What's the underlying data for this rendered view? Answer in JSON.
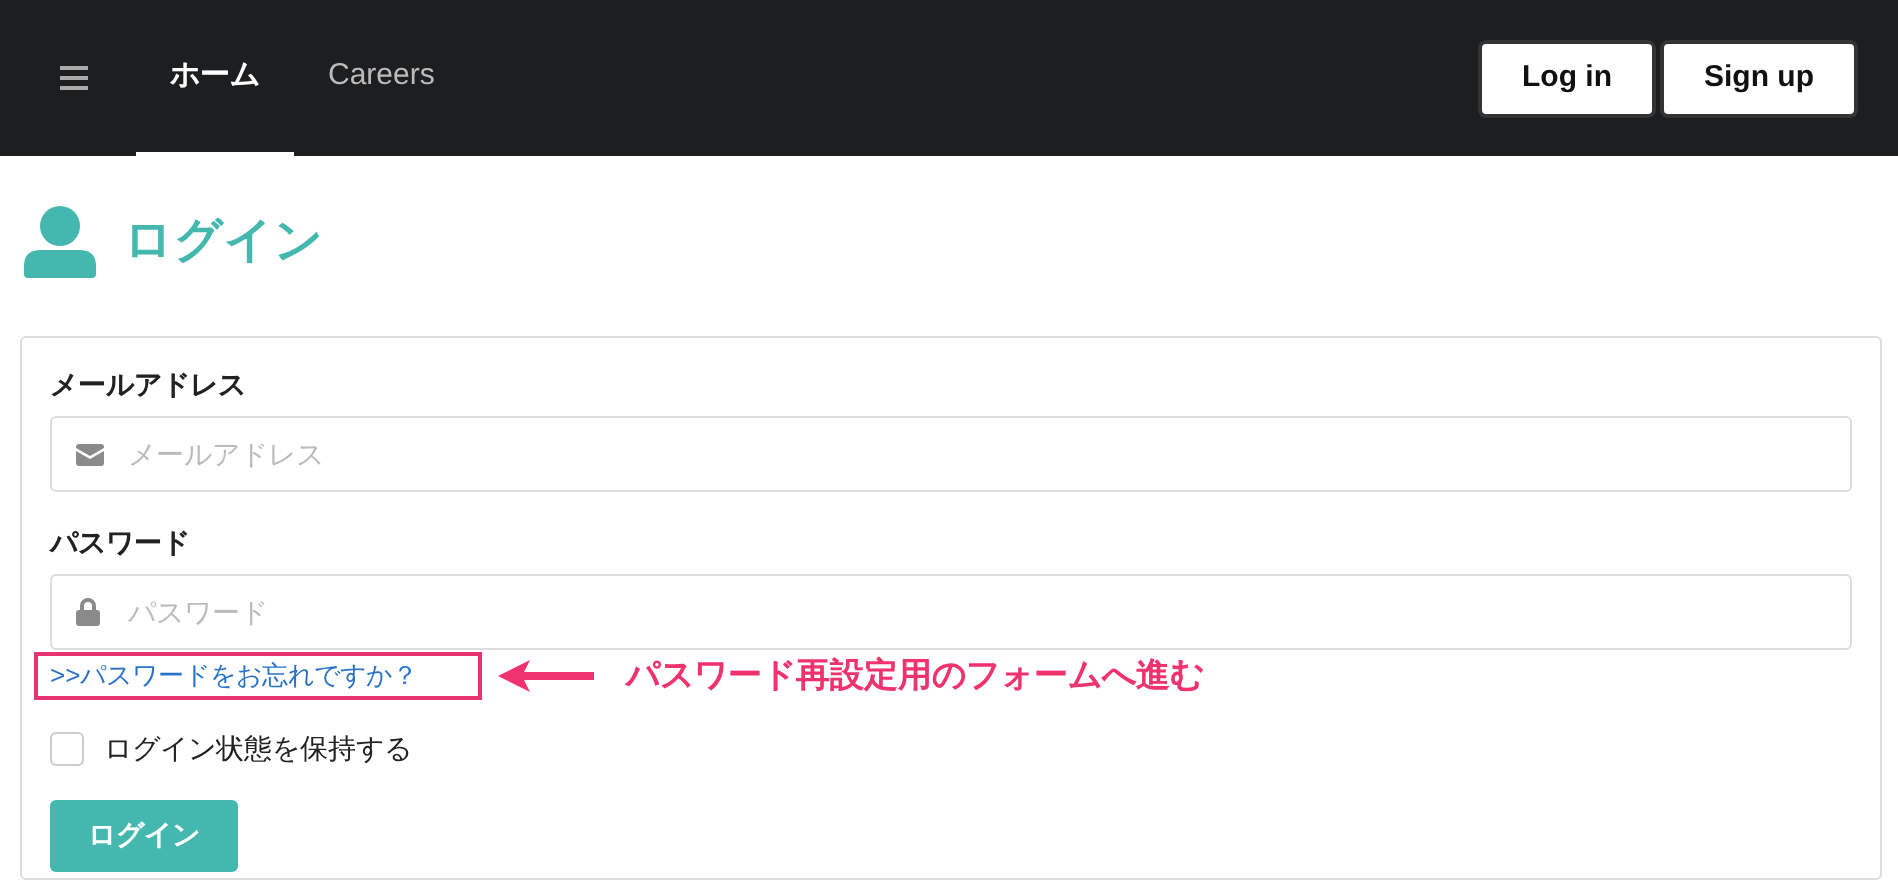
{
  "navbar": {
    "tabs": [
      {
        "label": "ホーム",
        "selected": true
      },
      {
        "label": "Careers",
        "selected": false
      }
    ],
    "buttons": [
      "Log in",
      "Sign up"
    ]
  },
  "heading": "ログイン",
  "form": {
    "fields": [
      {
        "label": "メールアドレス",
        "placeholder": "メールアドレス",
        "kind": "email"
      },
      {
        "label": "パスワード",
        "placeholder": "パスワード",
        "kind": "password"
      }
    ],
    "forgot_link": ">>パスワードをお忘れですか？",
    "remember": {
      "label": "ログイン状態を保持する",
      "checked": false
    },
    "submit": "ログイン"
  },
  "annotation": "パスワード再設定用のフォームへ進む"
}
